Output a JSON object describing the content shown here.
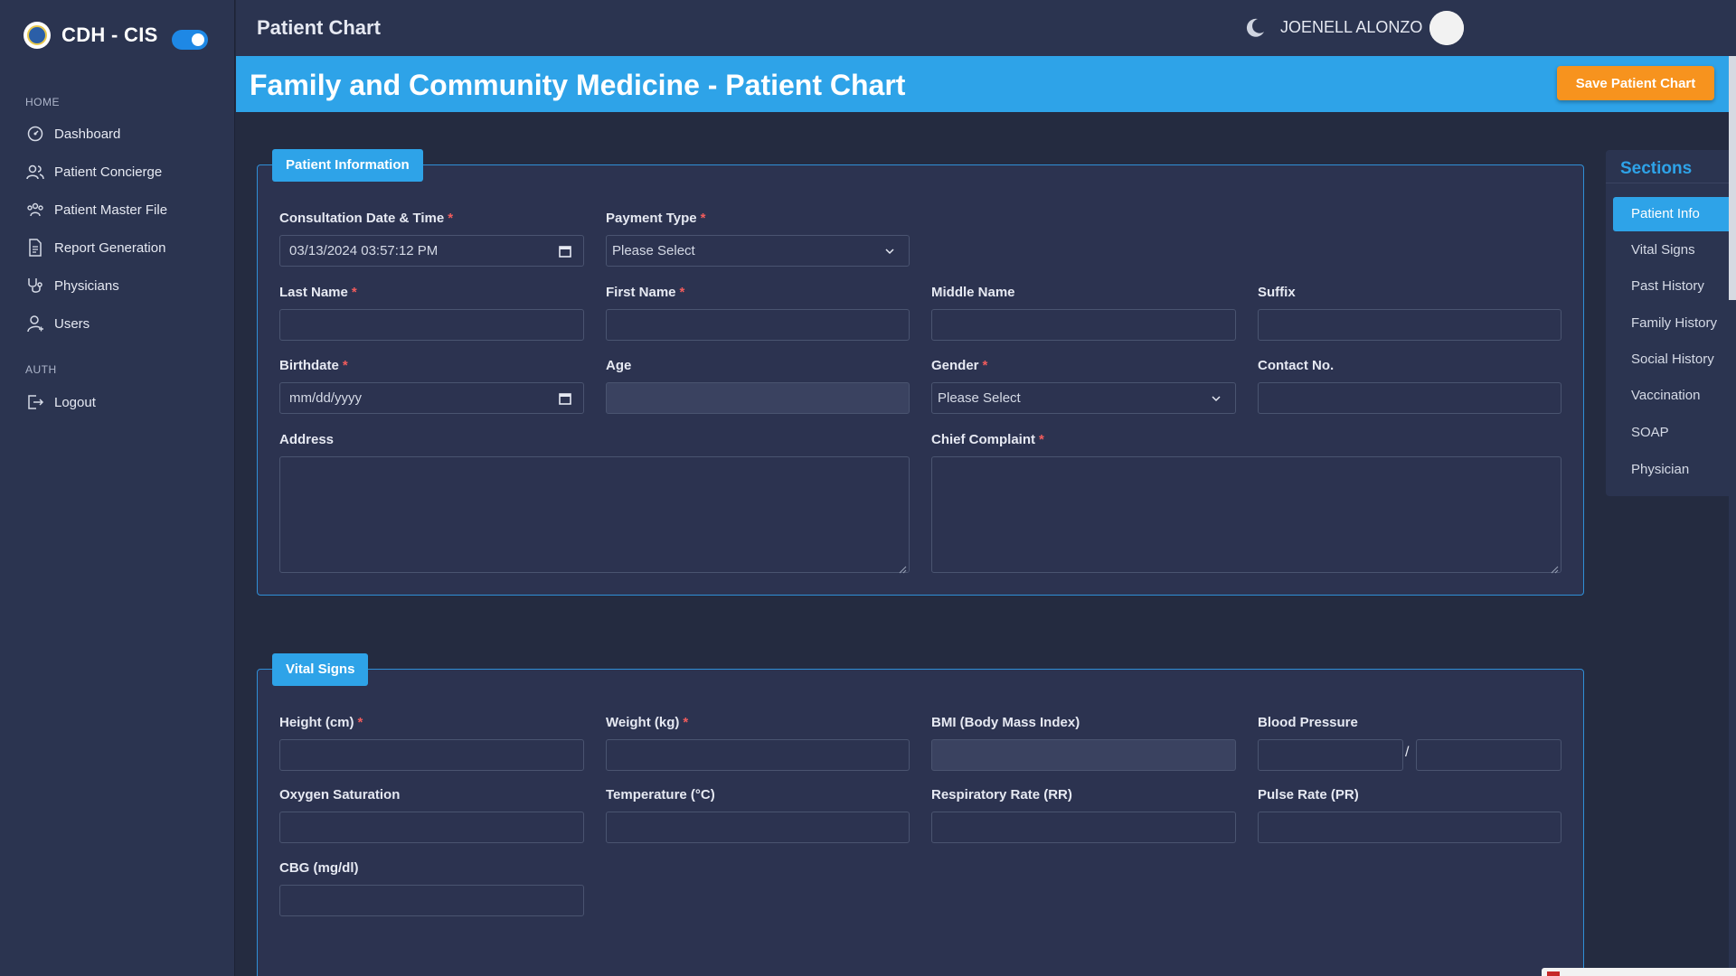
{
  "sidebar": {
    "brand": "CDH - CIS",
    "groups": [
      {
        "heading": "HOME"
      },
      {
        "heading": "AUTH"
      }
    ],
    "items": [
      {
        "label": "Dashboard",
        "icon": "dashboard-icon"
      },
      {
        "label": "Patient Concierge",
        "icon": "users-icon"
      },
      {
        "label": "Patient Master File",
        "icon": "people-group-icon"
      },
      {
        "label": "Report Generation",
        "icon": "document-icon"
      },
      {
        "label": "Physicians",
        "icon": "stethoscope-icon"
      },
      {
        "label": "Users",
        "icon": "user-icon"
      },
      {
        "label": "Logout",
        "icon": "logout-icon"
      }
    ]
  },
  "topbar": {
    "title": "Patient Chart",
    "user_name": "JOENELL ALONZO"
  },
  "banner": {
    "title": "Family and Community Medicine - Patient Chart",
    "save_label": "Save Patient Chart"
  },
  "patient_info": {
    "legend": "Patient Information",
    "consultation_label": "Consultation Date & Time",
    "consultation_value": "03/13/2024 03:57:12  PM",
    "payment_label": "Payment Type",
    "payment_value": "Please Select",
    "last_name_label": "Last Name",
    "first_name_label": "First Name",
    "middle_name_label": "Middle Name",
    "suffix_label": "Suffix",
    "birthdate_label": "Birthdate",
    "birthdate_placeholder": "mm/dd/yyyy",
    "age_label": "Age",
    "gender_label": "Gender",
    "gender_value": "Please Select",
    "contact_label": "Contact No.",
    "address_label": "Address",
    "complaint_label": "Chief Complaint"
  },
  "vital_signs": {
    "legend": "Vital Signs",
    "height_label": "Height (cm)",
    "weight_label": "Weight (kg)",
    "bmi_label": "BMI (Body Mass Index)",
    "bp_label": "Blood Pressure",
    "bp_separator": "/",
    "oxygen_label": "Oxygen Saturation",
    "temperature_label": "Temperature (°C)",
    "rr_label": "Respiratory Rate (RR)",
    "pr_label": "Pulse Rate (PR)",
    "cbg_label": "CBG (mg/dl)"
  },
  "sections_panel": {
    "title": "Sections",
    "items": [
      "Patient Info",
      "Vital Signs",
      "Past History",
      "Family History",
      "Social History",
      "Vaccination",
      "SOAP",
      "Physician"
    ],
    "active_index": 0
  },
  "colors": {
    "accent": "#2ea3e8",
    "save_button": "#f7931e",
    "required": "#f25c5c",
    "background": "#242b40"
  }
}
